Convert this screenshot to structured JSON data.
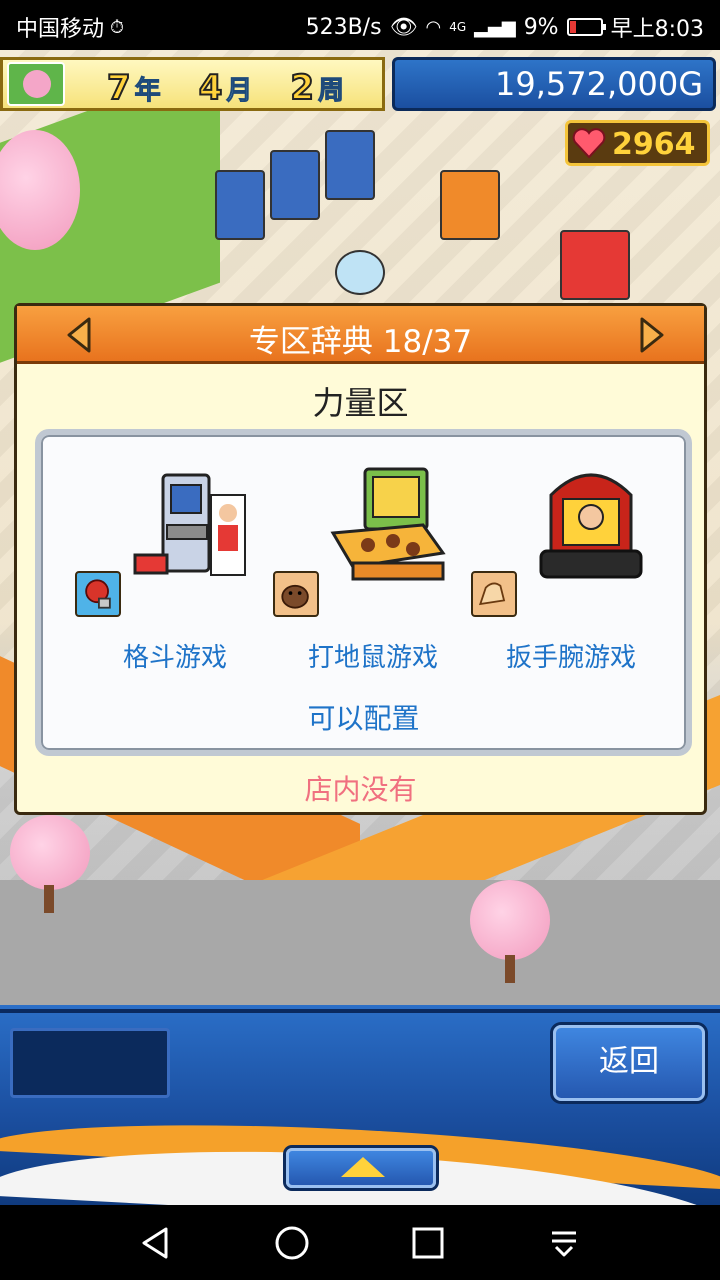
{
  "status_bar": {
    "carrier": "中国移动",
    "net_speed": "523B/s",
    "signal_label": "4G",
    "battery_percent": "9%",
    "time": "早上8:03"
  },
  "hud": {
    "year": "7",
    "year_unit": "年",
    "month": "4",
    "month_unit": "月",
    "week": "2",
    "week_unit": "周",
    "money": "19,572,000G",
    "hearts": "2964"
  },
  "dialog": {
    "title": "专区辞典 18/37",
    "zone_name": "力量区",
    "items": [
      {
        "label": "格斗游戏",
        "badge_icon": "boxing-glove-icon"
      },
      {
        "label": "打地鼠游戏",
        "badge_icon": "mole-icon"
      },
      {
        "label": "扳手腕游戏",
        "badge_icon": "arm-icon"
      }
    ],
    "placeable_text": "可以配置",
    "availability_text": "店内没有"
  },
  "bottom": {
    "back_label": "返回"
  },
  "colors": {
    "dialog_header": "#e8731e",
    "label_blue": "#1e73c8",
    "not_in_store_pink": "#f07080",
    "money_panel": "#1b4fa0"
  }
}
